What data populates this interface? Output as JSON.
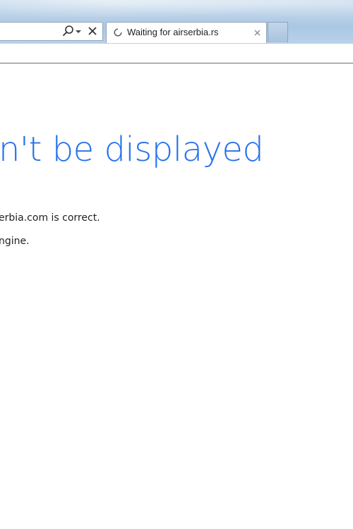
{
  "browser": {
    "tab": {
      "title": "Waiting for airserbia.rs",
      "loading": true
    },
    "address_bar": {
      "icons": [
        "search-icon",
        "chevron-down-icon",
        "close-icon"
      ]
    }
  },
  "error_page": {
    "headline": "n't be displayed",
    "lines": [
      "erbia.com is correct.",
      "ngine."
    ],
    "accent_color": "#2672ec"
  }
}
